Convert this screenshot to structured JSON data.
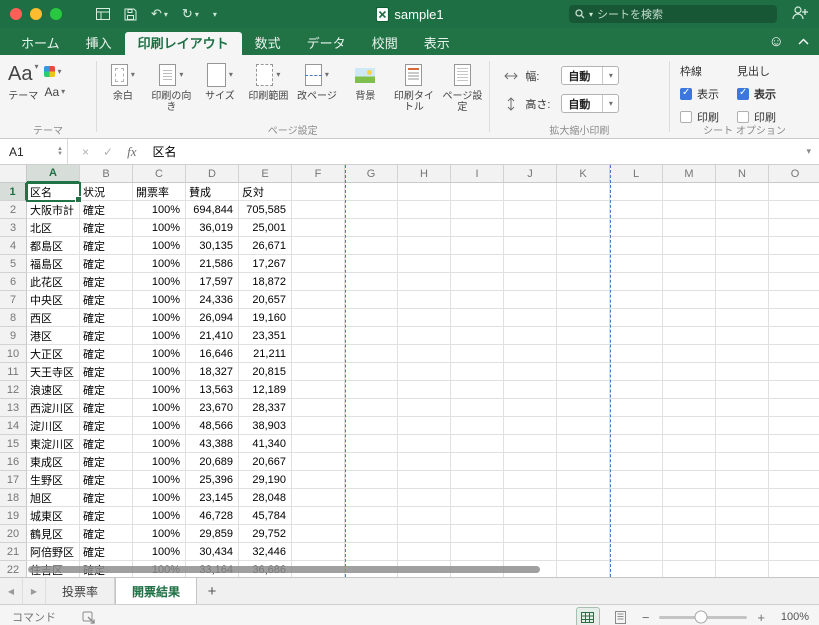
{
  "window": {
    "title": "sample1",
    "search_placeholder": "シートを検索"
  },
  "glyphs": {
    "caret": "▾",
    "undo": "↶",
    "redo": "↻",
    "smiley": "☺",
    "prev": "◀",
    "next": "▶",
    "add": "+",
    "zoom_out": "−",
    "zoom_in": "+",
    "cancel": "×",
    "enter": "✓"
  },
  "ribbon": {
    "tabs": [
      {
        "label": "ホーム",
        "active": false
      },
      {
        "label": "挿入",
        "active": false
      },
      {
        "label": "印刷レイアウト",
        "active": true
      },
      {
        "label": "数式",
        "active": false
      },
      {
        "label": "データ",
        "active": false
      },
      {
        "label": "校閲",
        "active": false
      },
      {
        "label": "表示",
        "active": false
      }
    ],
    "groups": {
      "themes": {
        "label": "テーマ",
        "theme_glyph": "Aa",
        "theme_label": "テーマ",
        "fonts_glyph": "Aa"
      },
      "page_setup": {
        "label": "ページ設定",
        "buttons": [
          "余白",
          "印刷の向き",
          "サイズ",
          "印刷範囲",
          "改ページ",
          "背景",
          "印刷タイトル",
          "ページ設定"
        ]
      },
      "scale": {
        "label": "拡大縮小印刷",
        "width_label": "幅:",
        "height_label": "高さ:",
        "width_value": "自動",
        "height_value": "自動"
      },
      "sheet_options": {
        "label": "シート オプション",
        "col1": "枠線",
        "col2": "見出し",
        "view": "表示",
        "print": "印刷",
        "gridlines_view_checked": true,
        "gridlines_print_checked": false,
        "headings_view_checked": true,
        "headings_print_checked": false
      }
    }
  },
  "formula_bar": {
    "cell_ref": "A1",
    "fx": "fx",
    "content": "区名"
  },
  "grid": {
    "columns": [
      "A",
      "B",
      "C",
      "D",
      "E",
      "F",
      "G",
      "H",
      "I",
      "J",
      "K",
      "L",
      "M",
      "N",
      "O"
    ],
    "selected_cell": "A1",
    "row1": [
      "区名",
      "状況",
      "開票率",
      "賛成",
      "反対"
    ],
    "rows": [
      [
        "大阪市計",
        "確定",
        "100%",
        "694,844",
        "705,585"
      ],
      [
        "北区",
        "確定",
        "100%",
        "36,019",
        "25,001"
      ],
      [
        "都島区",
        "確定",
        "100%",
        "30,135",
        "26,671"
      ],
      [
        "福島区",
        "確定",
        "100%",
        "21,586",
        "17,267"
      ],
      [
        "此花区",
        "確定",
        "100%",
        "17,597",
        "18,872"
      ],
      [
        "中央区",
        "確定",
        "100%",
        "24,336",
        "20,657"
      ],
      [
        "西区",
        "確定",
        "100%",
        "26,094",
        "19,160"
      ],
      [
        "港区",
        "確定",
        "100%",
        "21,410",
        "23,351"
      ],
      [
        "大正区",
        "確定",
        "100%",
        "16,646",
        "21,211"
      ],
      [
        "天王寺区",
        "確定",
        "100%",
        "18,327",
        "20,815"
      ],
      [
        "浪速区",
        "確定",
        "100%",
        "13,563",
        "12,189"
      ],
      [
        "西淀川区",
        "確定",
        "100%",
        "23,670",
        "28,337"
      ],
      [
        "淀川区",
        "確定",
        "100%",
        "48,566",
        "38,903"
      ],
      [
        "東淀川区",
        "確定",
        "100%",
        "43,388",
        "41,340"
      ],
      [
        "東成区",
        "確定",
        "100%",
        "20,689",
        "20,667"
      ],
      [
        "生野区",
        "確定",
        "100%",
        "25,396",
        "29,190"
      ],
      [
        "旭区",
        "確定",
        "100%",
        "23,145",
        "28,048"
      ],
      [
        "城東区",
        "確定",
        "100%",
        "46,728",
        "45,784"
      ],
      [
        "鶴見区",
        "確定",
        "100%",
        "29,859",
        "29,752"
      ],
      [
        "阿倍野区",
        "確定",
        "100%",
        "30,434",
        "32,446"
      ],
      [
        "住吉区",
        "確定",
        "100%",
        "33,164",
        "36,686"
      ]
    ]
  },
  "sheet_bar": {
    "tabs": [
      {
        "label": "投票率",
        "active": false
      },
      {
        "label": "開票結果",
        "active": true
      }
    ]
  },
  "status_bar": {
    "left": "コマンド",
    "zoom": "100%"
  }
}
